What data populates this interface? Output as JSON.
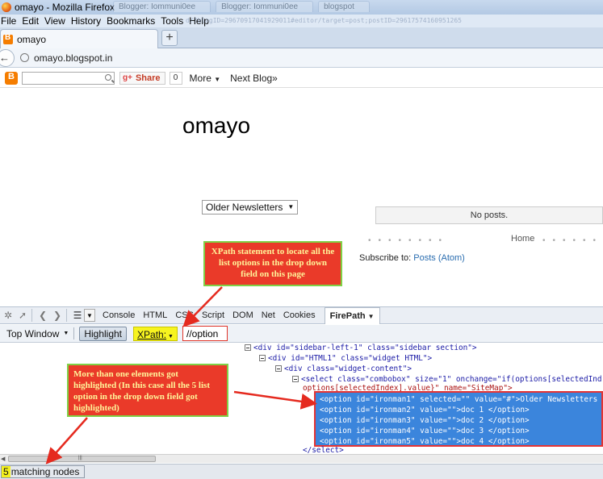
{
  "window": {
    "title": "omayo - Mozilla Firefox",
    "ghost_tabs": [
      "Blogger: Iommuni0ee",
      "Blogger: Iommuni0ee",
      "blogspot"
    ]
  },
  "menubar": {
    "items": [
      "File",
      "Edit",
      "View",
      "History",
      "Bookmarks",
      "Tools",
      "Help"
    ],
    "ghost_url": "d/?blogID=29670917041929011#editor/target=post;postID=29617574160951265"
  },
  "tab": {
    "label": "omayo",
    "new_tab": "+"
  },
  "navbar": {
    "url": "omayo.blogspot.in"
  },
  "blogger_navbar": {
    "share": "Share",
    "share_count": "0",
    "more": "More",
    "next_blog": "Next Blog»"
  },
  "page": {
    "blog_title": "omayo",
    "select_value": "Older Newsletters",
    "no_posts": "No posts.",
    "home": "Home",
    "subscribe_label": "Subscribe to:",
    "subscribe_link": "Posts (Atom)"
  },
  "callouts": {
    "top": "XPath statement to locate all the list options in the drop down field on this page",
    "bottom": "More than one elements got highlighted (In this case all the 5 list option in the drop down field got highlighted)"
  },
  "firebug": {
    "tabs": [
      "Console",
      "HTML",
      "CSS",
      "Script",
      "DOM",
      "Net",
      "Cookies"
    ],
    "active_tab": "FirePath"
  },
  "firepath": {
    "top_window": "Top Window",
    "highlight": "Highlight",
    "xpath_label": "XPath:",
    "xpath_value": "//option"
  },
  "tree": {
    "line1": "<div id=\"sidebar-left-1\" class=\"sidebar section\">",
    "line2": "<div id=\"HTML1\" class=\"widget HTML\">",
    "line3": "<div class=\"widget-content\">",
    "line4": "<select class=\"combobox\" size=\"1\" onchange=\"if(options[selectedInd",
    "line5": "options[selectedIndex].value}\" name=\"SiteMap\">",
    "close": "</select>",
    "options": [
      "<option id=\"ironman1\" selected=\"\" value=\"#\">Older Newsletters",
      "<option id=\"ironman2\" value=\"\">doc 1 </option>",
      "<option id=\"ironman3\" value=\"\">doc 2 </option>",
      "<option id=\"ironman4\" value=\"\">doc 3 </option>",
      "<option id=\"ironman5\" value=\"\">doc 4 </option>"
    ]
  },
  "status": {
    "count": "5",
    "text": "matching nodes"
  },
  "colors": {
    "callout_bg": "#ea3a29",
    "callout_border": "#7fd146",
    "callout_text": "#fff59a",
    "highlight_blue": "#3b85dc",
    "marker_yellow": "#f4f01e"
  }
}
